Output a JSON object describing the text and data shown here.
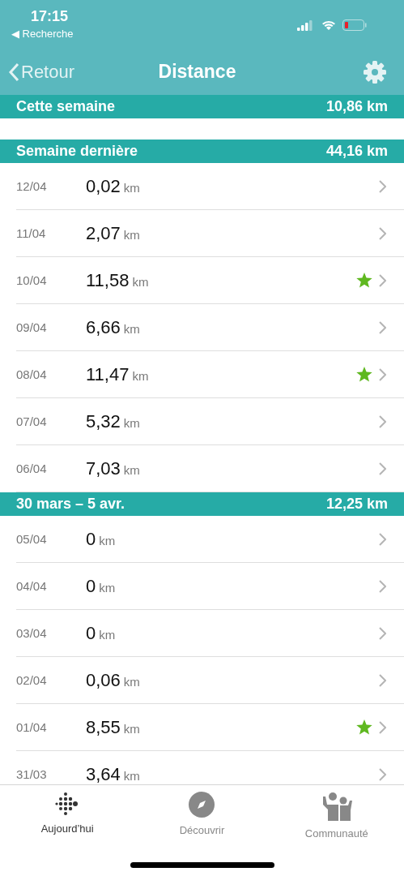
{
  "status_bar": {
    "time": "17:15",
    "back_app": "◀ Recherche"
  },
  "nav": {
    "back": "Retour",
    "title": "Distance"
  },
  "sections": [
    {
      "title": "Cette semaine",
      "total": "10,86 km"
    },
    {
      "title": "Semaine dernière",
      "total": "44,16 km",
      "rows": [
        {
          "date": "12/04",
          "value": "0,02",
          "unit": "km",
          "star": false
        },
        {
          "date": "11/04",
          "value": "2,07",
          "unit": "km",
          "star": false
        },
        {
          "date": "10/04",
          "value": "11,58",
          "unit": "km",
          "star": true
        },
        {
          "date": "09/04",
          "value": "6,66",
          "unit": "km",
          "star": false
        },
        {
          "date": "08/04",
          "value": "11,47",
          "unit": "km",
          "star": true
        },
        {
          "date": "07/04",
          "value": "5,32",
          "unit": "km",
          "star": false
        },
        {
          "date": "06/04",
          "value": "7,03",
          "unit": "km",
          "star": false
        }
      ]
    },
    {
      "title": "30 mars – 5 avr.",
      "total": "12,25 km",
      "rows": [
        {
          "date": "05/04",
          "value": "0",
          "unit": "km",
          "star": false
        },
        {
          "date": "04/04",
          "value": "0",
          "unit": "km",
          "star": false
        },
        {
          "date": "03/04",
          "value": "0",
          "unit": "km",
          "star": false
        },
        {
          "date": "02/04",
          "value": "0,06",
          "unit": "km",
          "star": false
        },
        {
          "date": "01/04",
          "value": "8,55",
          "unit": "km",
          "star": true
        },
        {
          "date": "31/03",
          "value": "3,64",
          "unit": "km",
          "star": false
        }
      ]
    }
  ],
  "tabs": [
    {
      "label": "Aujourd’hui",
      "kind": "today",
      "selected": true
    },
    {
      "label": "Découvrir",
      "kind": "discover",
      "selected": false
    },
    {
      "label": "Communauté",
      "kind": "community",
      "selected": false
    }
  ]
}
